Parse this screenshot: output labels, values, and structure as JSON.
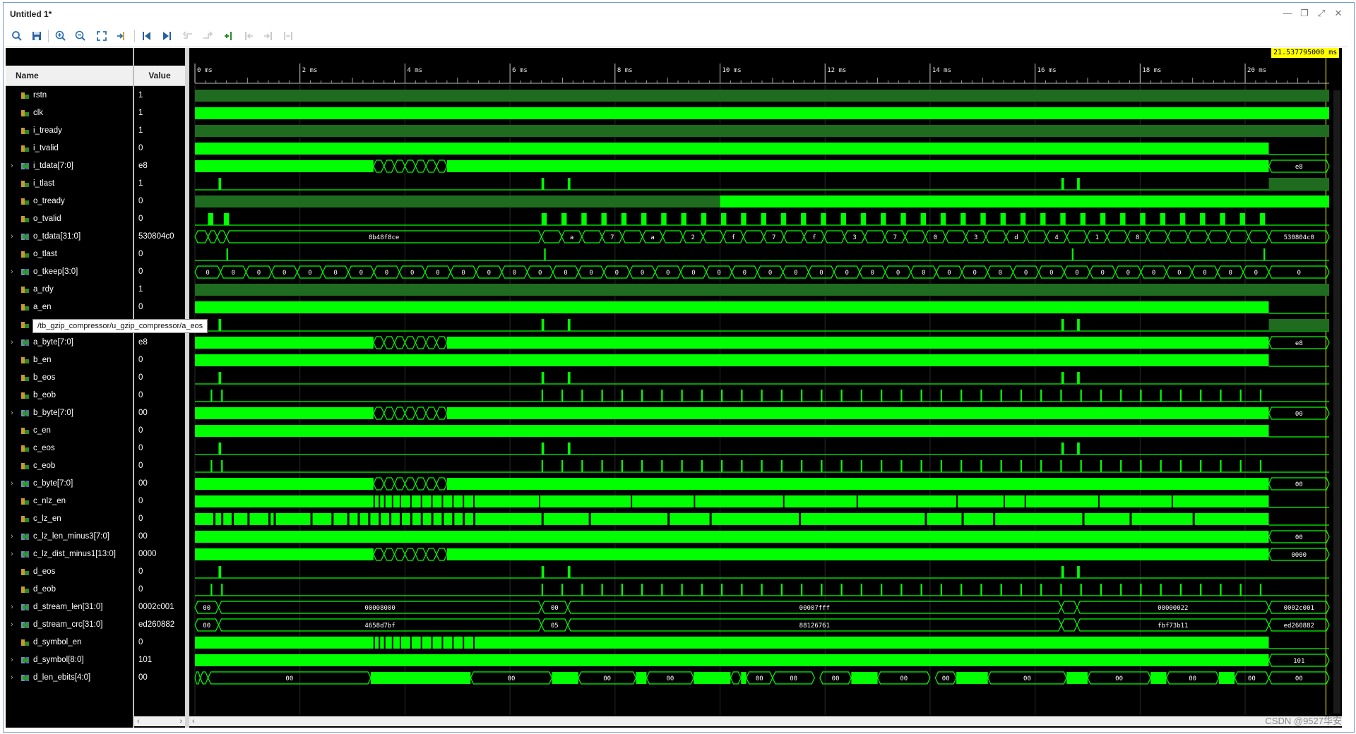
{
  "window": {
    "title": "Untitled 1*",
    "controls": [
      "minimize-icon",
      "restore-icon",
      "maximize-icon",
      "close-icon"
    ]
  },
  "toolbar": {
    "buttons": [
      {
        "icon": "search-icon",
        "enabled": true
      },
      {
        "icon": "save-icon",
        "enabled": true
      },
      {
        "icon": "zoom-in-icon",
        "enabled": true
      },
      {
        "icon": "zoom-out-icon",
        "enabled": true
      },
      {
        "icon": "zoom-fit-icon",
        "enabled": true
      },
      {
        "icon": "go-to-cursor-icon",
        "enabled": true
      },
      {
        "icon": "go-to-time-zero-icon",
        "enabled": true
      },
      {
        "icon": "go-to-last-time-icon",
        "enabled": true
      },
      {
        "icon": "previous-transition-icon",
        "enabled": false
      },
      {
        "icon": "next-transition-icon",
        "enabled": false
      },
      {
        "icon": "add-marker-icon",
        "enabled": true
      },
      {
        "icon": "previous-marker-icon",
        "enabled": false
      },
      {
        "icon": "next-marker-icon",
        "enabled": false
      },
      {
        "icon": "swap-cursors-icon",
        "enabled": false
      }
    ],
    "settings_icon": "gear-icon"
  },
  "columns": {
    "name": "Name",
    "value": "Value"
  },
  "cursor": {
    "label": "21.537795000 ms"
  },
  "timeline": {
    "unit": "ms",
    "ticks": [
      "0 ms",
      "2 ms",
      "4 ms",
      "6 ms",
      "8 ms",
      "10 ms",
      "12 ms",
      "14 ms",
      "16 ms",
      "18 ms",
      "20 ms"
    ],
    "range_ms": [
      0,
      21.6
    ]
  },
  "tooltip": "/tb_gzip_compressor/u_gzip_compressor/a_eos",
  "signals": [
    {
      "name": "rstn",
      "value": "1",
      "bus": false
    },
    {
      "name": "clk",
      "value": "1",
      "bus": false
    },
    {
      "name": "i_tready",
      "value": "1",
      "bus": false
    },
    {
      "name": "i_tvalid",
      "value": "0",
      "bus": false
    },
    {
      "name": "i_tdata[7:0]",
      "value": "e8",
      "bus": true
    },
    {
      "name": "i_tlast",
      "value": "1",
      "bus": false
    },
    {
      "name": "o_tready",
      "value": "0",
      "bus": false
    },
    {
      "name": "o_tvalid",
      "value": "0",
      "bus": false
    },
    {
      "name": "o_tdata[31:0]",
      "value": "530804c0",
      "bus": true
    },
    {
      "name": "o_tlast",
      "value": "0",
      "bus": false
    },
    {
      "name": "o_tkeep[3:0]",
      "value": "0",
      "bus": true
    },
    {
      "name": "a_rdy",
      "value": "1",
      "bus": false
    },
    {
      "name": "a_en",
      "value": "0",
      "bus": false
    },
    {
      "name": "",
      "value": "1",
      "bus": false
    },
    {
      "name": "a_byte[7:0]",
      "value": "e8",
      "bus": true
    },
    {
      "name": "b_en",
      "value": "0",
      "bus": false
    },
    {
      "name": "b_eos",
      "value": "0",
      "bus": false
    },
    {
      "name": "b_eob",
      "value": "0",
      "bus": false
    },
    {
      "name": "b_byte[7:0]",
      "value": "00",
      "bus": true
    },
    {
      "name": "c_en",
      "value": "0",
      "bus": false
    },
    {
      "name": "c_eos",
      "value": "0",
      "bus": false
    },
    {
      "name": "c_eob",
      "value": "0",
      "bus": false
    },
    {
      "name": "c_byte[7:0]",
      "value": "00",
      "bus": true
    },
    {
      "name": "c_nlz_en",
      "value": "0",
      "bus": false
    },
    {
      "name": "c_lz_en",
      "value": "0",
      "bus": false
    },
    {
      "name": "c_lz_len_minus3[7:0]",
      "value": "00",
      "bus": true
    },
    {
      "name": "c_lz_dist_minus1[13:0]",
      "value": "0000",
      "bus": true
    },
    {
      "name": "d_eos",
      "value": "0",
      "bus": false
    },
    {
      "name": "d_eob",
      "value": "0",
      "bus": false
    },
    {
      "name": "d_stream_len[31:0]",
      "value": "0002c001",
      "bus": true
    },
    {
      "name": "d_stream_crc[31:0]",
      "value": "ed260882",
      "bus": true
    },
    {
      "name": "d_symbol_en",
      "value": "0",
      "bus": false
    },
    {
      "name": "d_symbol[8:0]",
      "value": "101",
      "bus": true
    },
    {
      "name": "d_len_ebits[4:0]",
      "value": "00",
      "bus": true
    }
  ],
  "bus_segment_labels": {
    "o_tdata": [
      "8b48f8ce",
      "a",
      "7",
      "a",
      "2",
      "f",
      "7",
      "f",
      "3",
      "7",
      "0",
      "3",
      "d",
      "4",
      "1",
      "8",
      "530804c0"
    ],
    "o_tkeep": [
      "0",
      "0",
      "0",
      "0",
      "0",
      "0",
      "0",
      "0",
      "0",
      "0",
      "0",
      "0",
      "0",
      "0",
      "0",
      "0",
      "0",
      "0",
      "0",
      "0",
      "0",
      "0",
      "0",
      "0",
      "0",
      "0",
      "0",
      "0",
      "0",
      "0",
      "0",
      "0",
      "0",
      "0",
      "0",
      "0",
      "0",
      "0",
      "0",
      "0",
      "0",
      "0"
    ],
    "d_stream_len": [
      "00",
      "00008000",
      "00",
      "00007fff",
      "00000022",
      "0002c001"
    ],
    "d_stream_crc": [
      "00",
      "4658d7bf",
      "05",
      "88126761",
      "fbf73b11",
      "ed260882"
    ],
    "d_len_ebits": [
      "00",
      "00",
      "00",
      "00",
      "00",
      "00",
      "00",
      "00",
      "00",
      "00",
      "00",
      "00",
      "00",
      "00",
      "00"
    ],
    "end_values": {
      "i_tdata": "e8",
      "a_byte": "e8",
      "b_byte": "00",
      "c_byte": "00",
      "c_lz_len_minus3": "00",
      "c_lz_dist_minus1": "0000",
      "d_symbol": "101"
    }
  },
  "watermark": "CSDN @9527华安",
  "colors": {
    "wave_green": "#00ff00",
    "dim_green": "#1f6b1f",
    "background": "#000000",
    "cursor_label": "#ffff00"
  }
}
